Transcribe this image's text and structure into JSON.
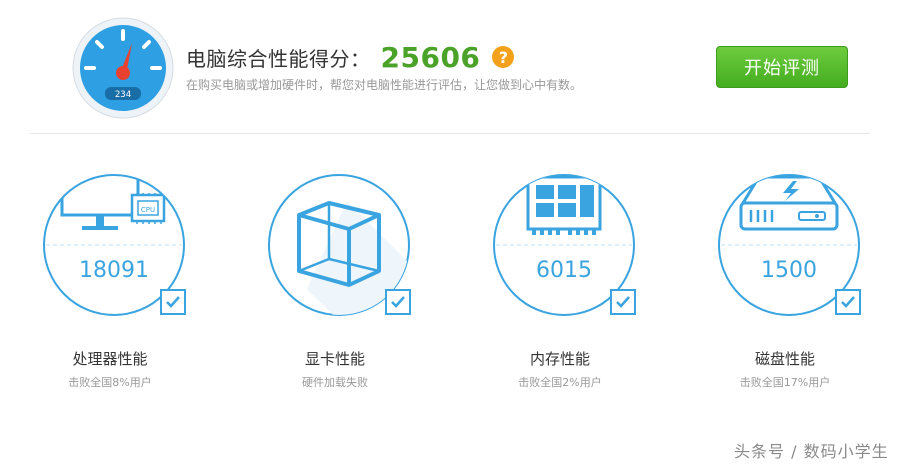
{
  "header": {
    "title_label": "电脑综合性能得分：",
    "total_score": "25606",
    "help_glyph": "?",
    "subtitle": "在购买电脑或增加硬件时，帮您对电脑性能进行评估，让您做到心中有数。",
    "start_button": "开始评测",
    "speedometer_readout": "234"
  },
  "cards": [
    {
      "title": "处理器性能",
      "score": "18091",
      "desc": "击败全国8%用户",
      "icon": "cpu-monitor-icon",
      "chip_label": "CPU"
    },
    {
      "title": "显卡性能",
      "score": "",
      "desc": "硬件加载失败",
      "icon": "cube-icon"
    },
    {
      "title": "内存性能",
      "score": "6015",
      "desc": "击败全国2%用户",
      "icon": "memory-chip-icon"
    },
    {
      "title": "磁盘性能",
      "score": "1500",
      "desc": "击败全国17%用户",
      "icon": "hard-disk-icon"
    }
  ],
  "watermark": "头条号 / 数码小学生",
  "colors": {
    "accent_blue": "#3aa4e0",
    "score_green": "#4aa229",
    "help_orange": "#f4a11a",
    "button_green": "#52b82b"
  }
}
